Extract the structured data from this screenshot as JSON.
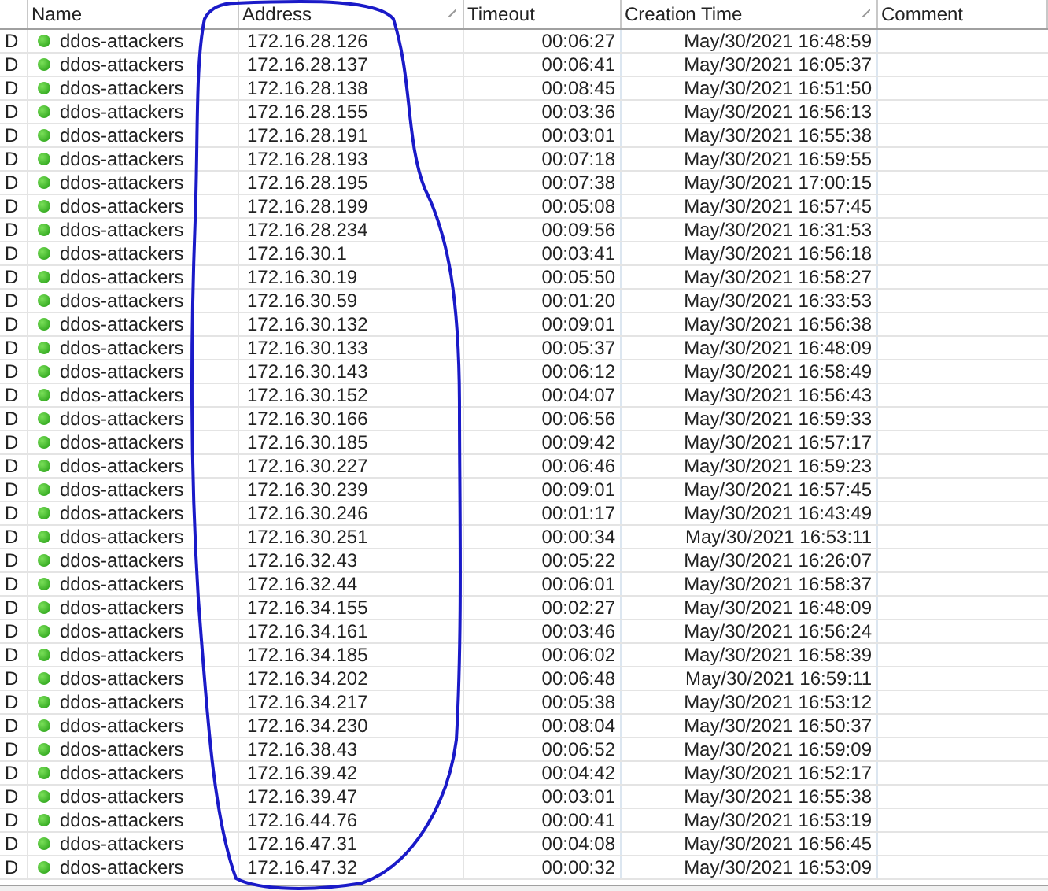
{
  "table": {
    "columns": [
      {
        "label": "Name"
      },
      {
        "label": "Address",
        "sorted": true
      },
      {
        "label": "Timeout"
      },
      {
        "label": "Creation Time",
        "sorted": true
      },
      {
        "label": "Comment"
      }
    ],
    "rows": [
      {
        "flag": "D",
        "name": "ddos-attackers",
        "address": "172.16.28.126",
        "timeout": "00:06:27",
        "created": "May/30/2021 16:48:59"
      },
      {
        "flag": "D",
        "name": "ddos-attackers",
        "address": "172.16.28.137",
        "timeout": "00:06:41",
        "created": "May/30/2021 16:05:37"
      },
      {
        "flag": "D",
        "name": "ddos-attackers",
        "address": "172.16.28.138",
        "timeout": "00:08:45",
        "created": "May/30/2021 16:51:50"
      },
      {
        "flag": "D",
        "name": "ddos-attackers",
        "address": "172.16.28.155",
        "timeout": "00:03:36",
        "created": "May/30/2021 16:56:13"
      },
      {
        "flag": "D",
        "name": "ddos-attackers",
        "address": "172.16.28.191",
        "timeout": "00:03:01",
        "created": "May/30/2021 16:55:38"
      },
      {
        "flag": "D",
        "name": "ddos-attackers",
        "address": "172.16.28.193",
        "timeout": "00:07:18",
        "created": "May/30/2021 16:59:55"
      },
      {
        "flag": "D",
        "name": "ddos-attackers",
        "address": "172.16.28.195",
        "timeout": "00:07:38",
        "created": "May/30/2021 17:00:15"
      },
      {
        "flag": "D",
        "name": "ddos-attackers",
        "address": "172.16.28.199",
        "timeout": "00:05:08",
        "created": "May/30/2021 16:57:45"
      },
      {
        "flag": "D",
        "name": "ddos-attackers",
        "address": "172.16.28.234",
        "timeout": "00:09:56",
        "created": "May/30/2021 16:31:53"
      },
      {
        "flag": "D",
        "name": "ddos-attackers",
        "address": "172.16.30.1",
        "timeout": "00:03:41",
        "created": "May/30/2021 16:56:18"
      },
      {
        "flag": "D",
        "name": "ddos-attackers",
        "address": "172.16.30.19",
        "timeout": "00:05:50",
        "created": "May/30/2021 16:58:27"
      },
      {
        "flag": "D",
        "name": "ddos-attackers",
        "address": "172.16.30.59",
        "timeout": "00:01:20",
        "created": "May/30/2021 16:33:53"
      },
      {
        "flag": "D",
        "name": "ddos-attackers",
        "address": "172.16.30.132",
        "timeout": "00:09:01",
        "created": "May/30/2021 16:56:38"
      },
      {
        "flag": "D",
        "name": "ddos-attackers",
        "address": "172.16.30.133",
        "timeout": "00:05:37",
        "created": "May/30/2021 16:48:09"
      },
      {
        "flag": "D",
        "name": "ddos-attackers",
        "address": "172.16.30.143",
        "timeout": "00:06:12",
        "created": "May/30/2021 16:58:49"
      },
      {
        "flag": "D",
        "name": "ddos-attackers",
        "address": "172.16.30.152",
        "timeout": "00:04:07",
        "created": "May/30/2021 16:56:43"
      },
      {
        "flag": "D",
        "name": "ddos-attackers",
        "address": "172.16.30.166",
        "timeout": "00:06:56",
        "created": "May/30/2021 16:59:33"
      },
      {
        "flag": "D",
        "name": "ddos-attackers",
        "address": "172.16.30.185",
        "timeout": "00:09:42",
        "created": "May/30/2021 16:57:17"
      },
      {
        "flag": "D",
        "name": "ddos-attackers",
        "address": "172.16.30.227",
        "timeout": "00:06:46",
        "created": "May/30/2021 16:59:23"
      },
      {
        "flag": "D",
        "name": "ddos-attackers",
        "address": "172.16.30.239",
        "timeout": "00:09:01",
        "created": "May/30/2021 16:57:45"
      },
      {
        "flag": "D",
        "name": "ddos-attackers",
        "address": "172.16.30.246",
        "timeout": "00:01:17",
        "created": "May/30/2021 16:43:49"
      },
      {
        "flag": "D",
        "name": "ddos-attackers",
        "address": "172.16.30.251",
        "timeout": "00:00:34",
        "created": "May/30/2021 16:53:11"
      },
      {
        "flag": "D",
        "name": "ddos-attackers",
        "address": "172.16.32.43",
        "timeout": "00:05:22",
        "created": "May/30/2021 16:26:07"
      },
      {
        "flag": "D",
        "name": "ddos-attackers",
        "address": "172.16.32.44",
        "timeout": "00:06:01",
        "created": "May/30/2021 16:58:37"
      },
      {
        "flag": "D",
        "name": "ddos-attackers",
        "address": "172.16.34.155",
        "timeout": "00:02:27",
        "created": "May/30/2021 16:48:09"
      },
      {
        "flag": "D",
        "name": "ddos-attackers",
        "address": "172.16.34.161",
        "timeout": "00:03:46",
        "created": "May/30/2021 16:56:24"
      },
      {
        "flag": "D",
        "name": "ddos-attackers",
        "address": "172.16.34.185",
        "timeout": "00:06:02",
        "created": "May/30/2021 16:58:39"
      },
      {
        "flag": "D",
        "name": "ddos-attackers",
        "address": "172.16.34.202",
        "timeout": "00:06:48",
        "created": "May/30/2021 16:59:11"
      },
      {
        "flag": "D",
        "name": "ddos-attackers",
        "address": "172.16.34.217",
        "timeout": "00:05:38",
        "created": "May/30/2021 16:53:12"
      },
      {
        "flag": "D",
        "name": "ddos-attackers",
        "address": "172.16.34.230",
        "timeout": "00:08:04",
        "created": "May/30/2021 16:50:37"
      },
      {
        "flag": "D",
        "name": "ddos-attackers",
        "address": "172.16.38.43",
        "timeout": "00:06:52",
        "created": "May/30/2021 16:59:09"
      },
      {
        "flag": "D",
        "name": "ddos-attackers",
        "address": "172.16.39.42",
        "timeout": "00:04:42",
        "created": "May/30/2021 16:52:17"
      },
      {
        "flag": "D",
        "name": "ddos-attackers",
        "address": "172.16.39.47",
        "timeout": "00:03:01",
        "created": "May/30/2021 16:55:38"
      },
      {
        "flag": "D",
        "name": "ddos-attackers",
        "address": "172.16.44.76",
        "timeout": "00:00:41",
        "created": "May/30/2021 16:53:19"
      },
      {
        "flag": "D",
        "name": "ddos-attackers",
        "address": "172.16.47.31",
        "timeout": "00:04:08",
        "created": "May/30/2021 16:56:45"
      },
      {
        "flag": "D",
        "name": "ddos-attackers",
        "address": "172.16.47.32",
        "timeout": "00:00:32",
        "created": "May/30/2021 16:53:09"
      }
    ]
  }
}
